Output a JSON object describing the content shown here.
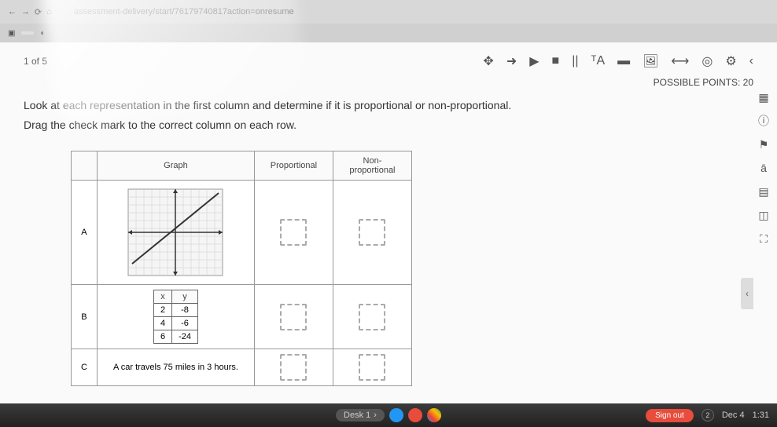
{
  "browser": {
    "url": "assessment-delivery/start/76179740817action=onresume"
  },
  "tabs": {
    "tab1": ""
  },
  "progress": "1 of 5",
  "toolbar_icons": {
    "move": "✥",
    "pointer": "➜",
    "play": "▶",
    "stop": "■",
    "pause": "||",
    "text": "ᵀA",
    "book": "▬",
    "image": "🖼",
    "width": "⟷",
    "target": "◎",
    "gear": "⚙",
    "back": "‹"
  },
  "points_label": "POSSIBLE POINTS: 20",
  "instructions": {
    "line1": "Look at each representation in the first column and determine if it is proportional or non-proportional.",
    "line2": "Drag the check mark to the correct column on each row."
  },
  "table_headers": {
    "blank": "",
    "graph": "Graph",
    "prop": "Proportional",
    "nonprop": "Non-proportional"
  },
  "rows": {
    "a": {
      "label": "A"
    },
    "b": {
      "label": "B",
      "xh": "x",
      "yh": "y",
      "x1": "2",
      "y1": "-8",
      "x2": "4",
      "y2": "-6",
      "x3": "6",
      "y3": "-24"
    },
    "c": {
      "label": "C",
      "text": "A car travels 75 miles in 3 hours."
    }
  },
  "sidebar_icons": {
    "i1": "▦",
    "i2": "ⓘ",
    "i3": "⚑",
    "i4": "ā",
    "i5": "▤",
    "i6": "◫",
    "i7": "⛶"
  },
  "collapse": "‹",
  "taskbar": {
    "desk": "Desk 1",
    "arrow": "›",
    "signout": "Sign out",
    "notif": "2",
    "date": "Dec 4",
    "time": "1:31"
  },
  "chart_data": {
    "type": "line",
    "title": "",
    "xlabel": "",
    "ylabel": "",
    "xlim": [
      -10,
      10
    ],
    "ylim": [
      -10,
      10
    ],
    "series": [
      {
        "name": "line",
        "points": [
          [
            -10,
            -8
          ],
          [
            10,
            12
          ]
        ]
      }
    ],
    "note": "A straight line with positive slope that does not pass through the origin (y-intercept approximately 2)."
  }
}
